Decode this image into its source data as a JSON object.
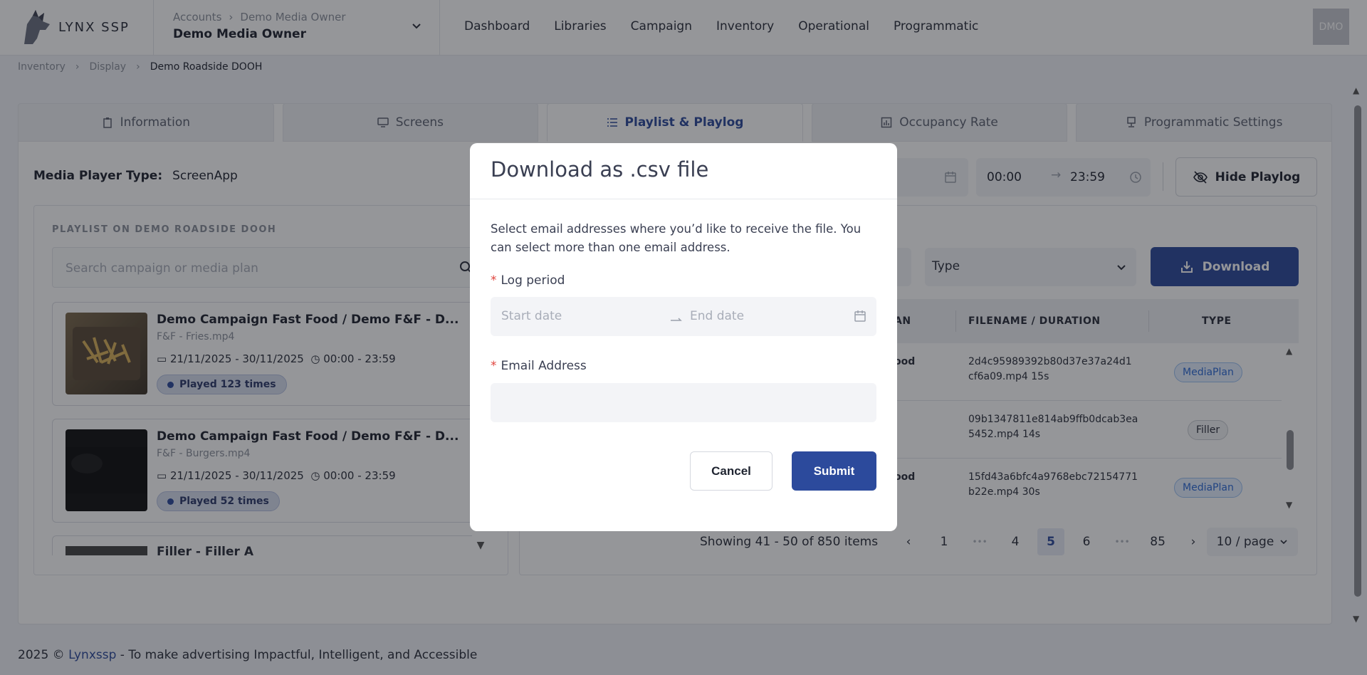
{
  "app": {
    "logo_text": "LYNX SSP",
    "avatar": "DMO"
  },
  "account": {
    "breadcrumb": [
      "Accounts",
      "Demo Media Owner"
    ],
    "name": "Demo Media Owner"
  },
  "nav": [
    "Dashboard",
    "Libraries",
    "Campaign",
    "Inventory",
    "Operational",
    "Programmatic"
  ],
  "breadcrumb": [
    "Inventory",
    "Display",
    "Demo Roadside DOOH"
  ],
  "tabs": [
    {
      "label": "Information",
      "icon": "clipboard-icon"
    },
    {
      "label": "Screens",
      "icon": "monitor-icon"
    },
    {
      "label": "Playlist & Playlog",
      "icon": "list-icon"
    },
    {
      "label": "Occupancy Rate",
      "icon": "bar-chart-icon"
    },
    {
      "label": "Programmatic Settings",
      "icon": "desktop-icon"
    }
  ],
  "media_player": {
    "label": "Media Player Type:",
    "value": "ScreenApp"
  },
  "time_range": {
    "start": "00:00",
    "end": "23:59"
  },
  "hide_playlog_label": "Hide Playlog",
  "playlist": {
    "title": "PLAYLIST ON DEMO ROADSIDE DOOH",
    "search_placeholder": "Search campaign or media plan",
    "cards": [
      {
        "title": "Demo Campaign Fast Food / Demo F&F - D...",
        "file": "F&F - Fries.mp4",
        "dates": "21/11/2025 - 30/11/2025",
        "time": "00:00 - 23:59",
        "played": "Played 123 times"
      },
      {
        "title": "Demo Campaign Fast Food / Demo F&F - D...",
        "file": "F&F - Burgers.mp4",
        "dates": "21/11/2025 - 30/11/2025",
        "time": "00:00 - 23:59",
        "played": "Played 52 times"
      },
      {
        "title": "Filler - Filler A"
      }
    ]
  },
  "playlog": {
    "type_placeholder": "Type",
    "download_label": "Download",
    "headers": [
      "AN",
      "FILENAME / DURATION",
      "TYPE"
    ],
    "rows": [
      {
        "col1": "ood",
        "filename": "2d4c95989392b80d37e37a24d1",
        "filename2": "cf6a09.mp4 15s",
        "type": "MediaPlan"
      },
      {
        "col1": "",
        "filename": "09b1347811e814ab9ffb0dcab3ea",
        "filename2": "5452.mp4 14s",
        "type": "Filler"
      },
      {
        "col1": "ood",
        "filename": "15fd43a6bfc4a9768ebc72154771",
        "filename2": "b22e.mp4 30s",
        "type": "MediaPlan"
      }
    ],
    "pagination": {
      "summary": "Showing 41 - 50 of 850 items",
      "pages": [
        "1",
        "4",
        "5",
        "6",
        "85"
      ],
      "current": "5",
      "ellipsis": "•••",
      "per_page": "10 / page"
    }
  },
  "footer": {
    "year": "2025 ©",
    "brand": "Lynxssp",
    "tagline": "- To make advertising Impactful, Intelligent, and Accessible"
  },
  "modal": {
    "title": "Download as .csv file",
    "description": "Select email addresses where you’d like to receive the file. You can select more than one email address.",
    "log_period_label": "Log period",
    "start_placeholder": "Start date",
    "end_placeholder": "End date",
    "email_label": "Email Address",
    "email_value": "",
    "required_mark": "*",
    "cancel_label": "Cancel",
    "submit_label": "Submit"
  },
  "colors": {
    "primary": "#2c4a9c",
    "required": "#e0443d",
    "mediaplan_badge": "#2c6ad6"
  }
}
